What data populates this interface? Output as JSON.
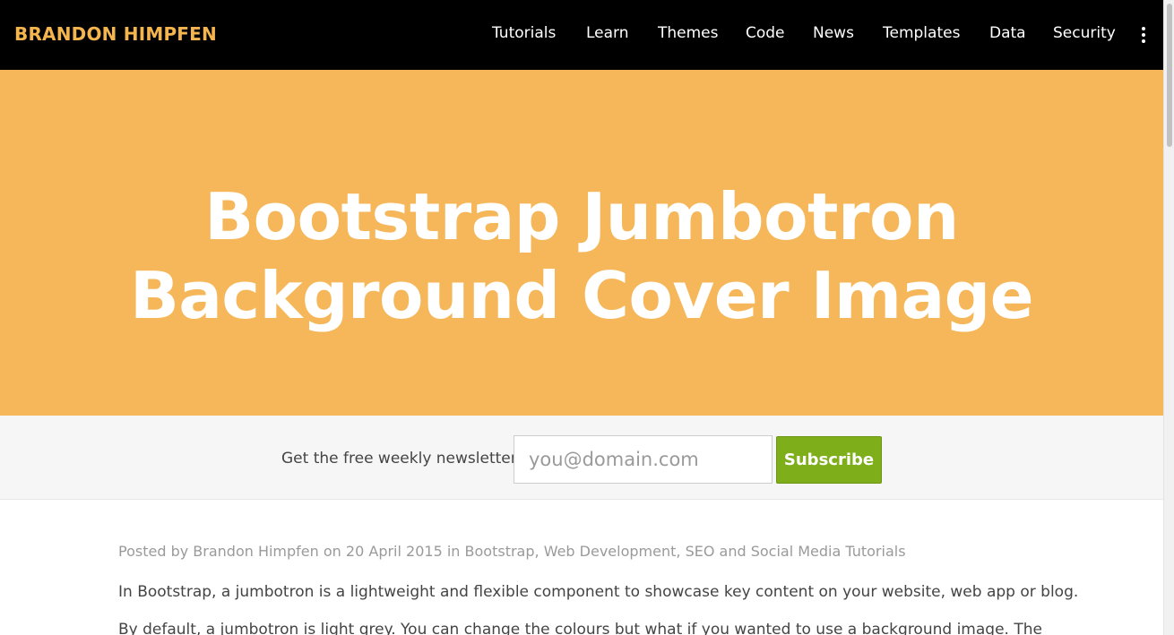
{
  "navbar": {
    "brand": "BRANDON HIMPFEN",
    "items": [
      {
        "label": "Tutorials"
      },
      {
        "label": "Learn"
      },
      {
        "label": "Themes"
      },
      {
        "label": "Code"
      },
      {
        "label": "News"
      },
      {
        "label": "Templates"
      },
      {
        "label": "Data"
      },
      {
        "label": "Security"
      }
    ],
    "more_icon": "kebab-menu-icon"
  },
  "jumbotron": {
    "title_line1": "Bootstrap Jumbotron",
    "title_line2": "Background Cover Image",
    "background_color": "#f5b75a"
  },
  "newsletter": {
    "label": "Get the free weekly newsletter:",
    "email_placeholder": "you@domain.com",
    "subscribe_label": "Subscribe",
    "button_color": "#7fae1b"
  },
  "post": {
    "meta_prefix": "Posted by",
    "author": "Brandon Himpfen",
    "on": "on",
    "date": "20 April 2015",
    "in": "in",
    "categories": [
      "Bootstrap",
      "Web Development",
      "SEO and Social Media Tutorials"
    ],
    "paragraph1": "In Bootstrap, a jumbotron is a lightweight and flexible component to showcase key content on your website, web app or blog.",
    "paragraph2": "By default, a jumbotron is light grey. You can change the colours but what if you wanted to use a background image. The"
  },
  "colors": {
    "brand": "#f5b54e",
    "navbar_bg": "#000000",
    "text": "#444444",
    "meta": "#9a9a9a"
  }
}
